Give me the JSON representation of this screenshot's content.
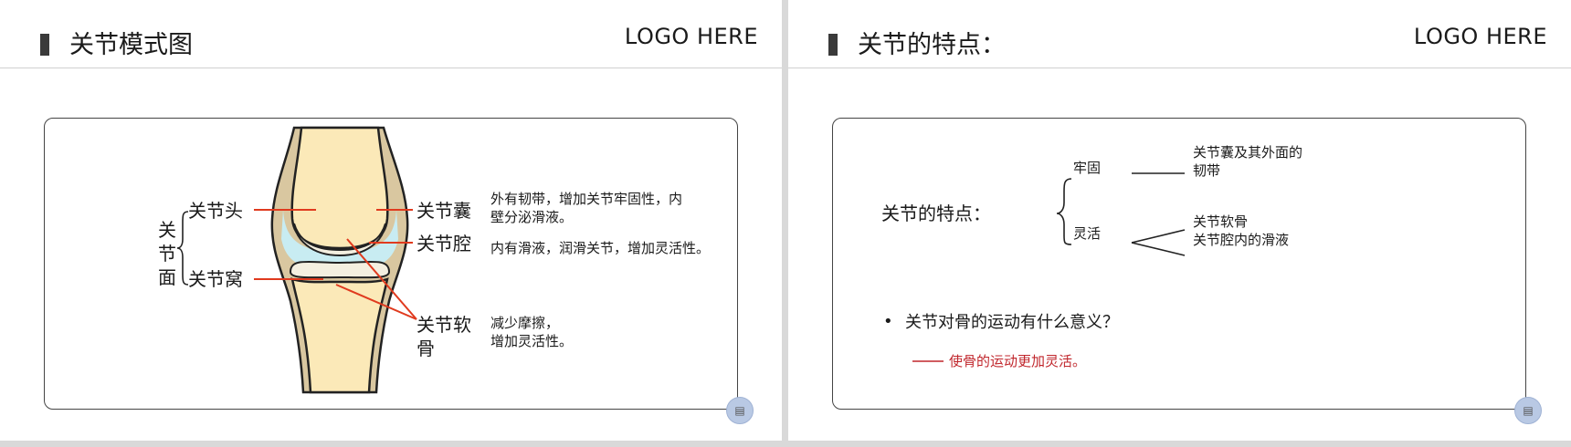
{
  "left_slide": {
    "title": "关节模式图",
    "logo": "LOGO HERE",
    "labels": {
      "joint_surface": [
        "关",
        "节",
        "面"
      ],
      "joint_head": "关节头",
      "joint_socket": "关节窝",
      "capsule": "关节囊",
      "cavity": "关节腔",
      "cartilage_1": "关节软",
      "cartilage_2": "骨"
    },
    "descriptions": {
      "capsule_1": "外有韧带，增加关节牢固性，内",
      "capsule_2": "壁分泌滑液。",
      "cavity": "内有滑液，润滑关节，增加灵活性。",
      "cartilage_1": "减少摩擦，",
      "cartilage_2": "增加灵活性。"
    },
    "corner_icon": "presenter-icon"
  },
  "right_slide": {
    "title": "关节的特点：",
    "logo": "LOGO HERE",
    "main_label": "关节的特点：",
    "branch_firm": "牢固",
    "firm_detail_1": "关节囊及其外面的",
    "firm_detail_2": "韧带",
    "branch_flexible": "灵活",
    "flex_detail_1": "关节软骨",
    "flex_detail_2": "关节腔内的滑液",
    "question": "关节对骨的运动有什么意义？",
    "answer": "使骨的运动更加灵活。",
    "corner_icon": "presenter-icon"
  },
  "colors": {
    "pointer_red": "#e03a1e",
    "answer_red": "#c0262c",
    "bone": "#fbe9b8",
    "capsule": "#d9c7a0",
    "cavity": "#c8ecf2"
  }
}
